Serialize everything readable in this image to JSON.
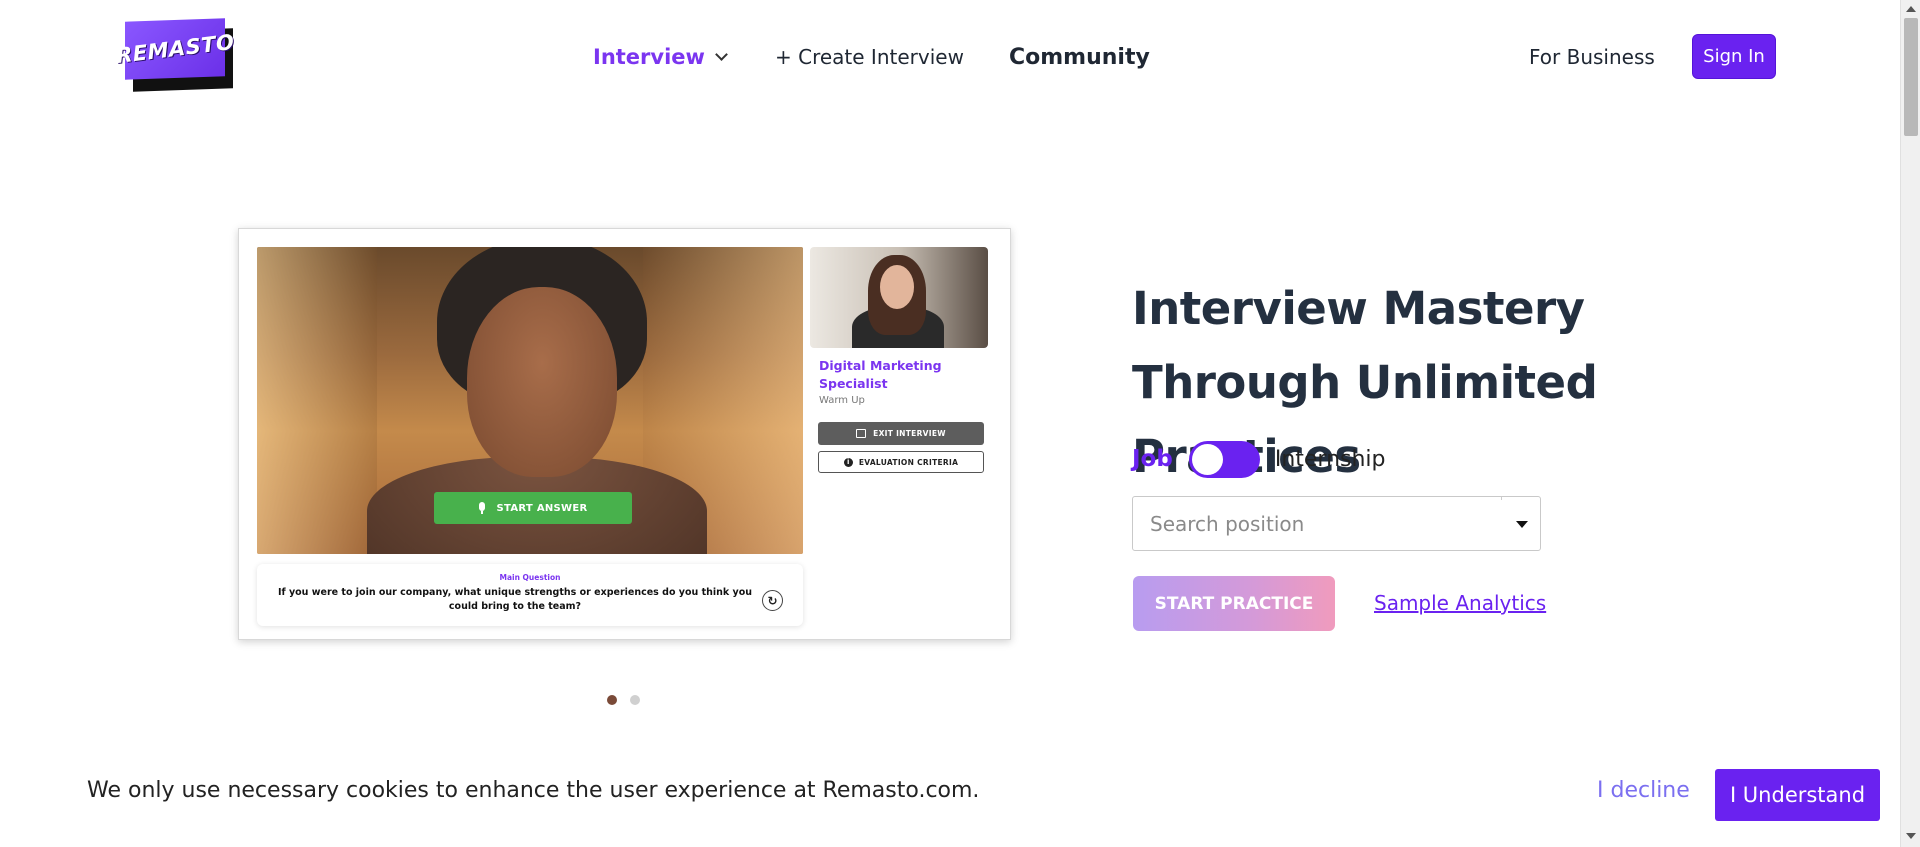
{
  "brand": {
    "logo_text": "REMASTO"
  },
  "nav": {
    "interview": "Interview",
    "create_interview": "+ Create Interview",
    "community": "Community",
    "for_business": "For Business",
    "sign_in": "Sign In"
  },
  "preview": {
    "start_answer": "START ANSWER",
    "question_label": "Main Question",
    "question_text": "If you were to join our company, what unique strengths or experiences do you think you could bring to the team?",
    "job_title": "Digital Marketing Specialist",
    "stage": "Warm Up",
    "exit_interview": "EXIT INTERVIEW",
    "evaluation_criteria": "EVALUATION CRITERIA",
    "slides": 2,
    "active_slide": 1
  },
  "hero": {
    "title": "Interview Mastery Through Unlimited Practices",
    "toggle_left": "Job",
    "toggle_right": "Internship",
    "search_placeholder": "Search position",
    "start_practice": "START PRACTICE",
    "sample_analytics": "Sample Analytics"
  },
  "cookie": {
    "message": "We only use necessary cookies to enhance the user experience at Remasto.com.",
    "decline": "I decline",
    "accept": "I Understand"
  },
  "colors": {
    "accent": "#6a22f0",
    "nav_active": "#7b35f0",
    "start_answer_green": "#48b14c"
  }
}
